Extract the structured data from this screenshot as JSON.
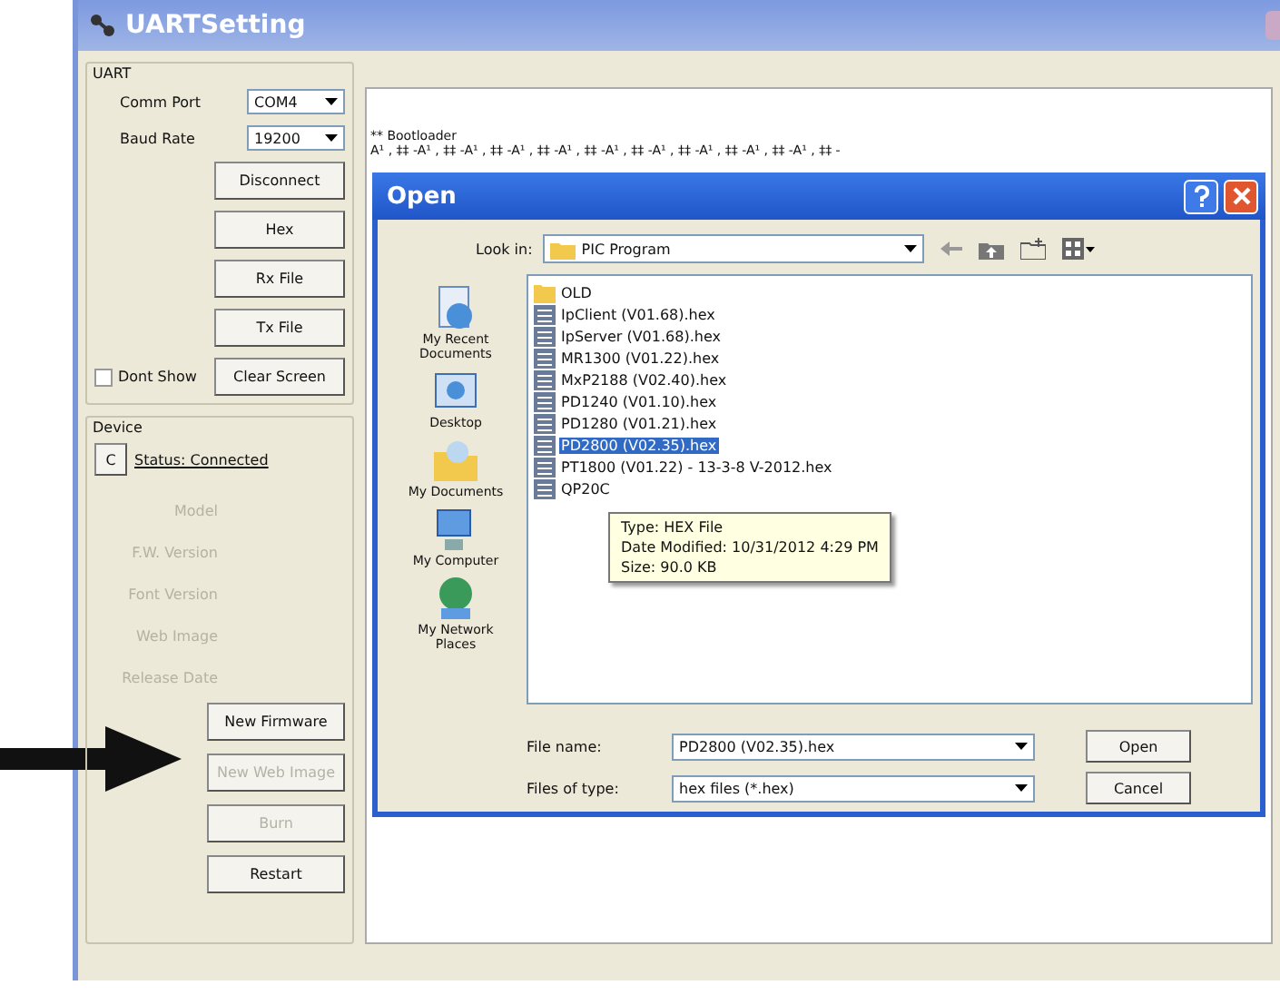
{
  "window": {
    "title": "UARTSetting"
  },
  "uart": {
    "title": "UART",
    "comm_port": {
      "label": "Comm Port",
      "value": "COM4"
    },
    "baud_rate": {
      "label": "Baud Rate",
      "value": "19200"
    },
    "buttons": [
      {
        "label": "Disconnect",
        "disabled": false
      },
      {
        "label": "Hex",
        "disabled": false
      },
      {
        "label": "Rx File",
        "disabled": false
      },
      {
        "label": "Tx File",
        "disabled": false
      }
    ],
    "dont_show": {
      "label": "Dont Show",
      "checked": false
    },
    "clear_button": "Clear Screen"
  },
  "device": {
    "title": "Device",
    "connect_button": "C",
    "status": "Status: Connected",
    "fields": [
      {
        "label": "Model",
        "disabled": true
      },
      {
        "label": "F.W. Version",
        "disabled": true
      },
      {
        "label": "Font Version",
        "disabled": true
      },
      {
        "label": "Web Image",
        "disabled": true
      },
      {
        "label": "Release Date",
        "disabled": true
      }
    ],
    "buttons": [
      {
        "label": "New Firmware",
        "disabled": false
      },
      {
        "label": "New Web Image",
        "disabled": true
      },
      {
        "label": "Burn",
        "disabled": true
      },
      {
        "label": "Restart",
        "disabled": false
      }
    ]
  },
  "console": {
    "lines": [
      "** Bootloader",
      "A¹ , ‡‡ -A¹ , ‡‡ -A¹ , ‡‡ -A¹ , ‡‡ -A¹ , ‡‡ -A¹ , ‡‡ -A¹ , ‡‡ -A¹ , ‡‡ -A¹ , ‡‡ -A¹ , ‡‡ -"
    ]
  },
  "open_dialog": {
    "title": "Open",
    "look_in": {
      "label": "Look in:",
      "value": "PIC Program"
    },
    "places": [
      {
        "label": "My Recent Documents",
        "kind": "recent"
      },
      {
        "label": "Desktop",
        "kind": "desktop"
      },
      {
        "label": "My Documents",
        "kind": "documents"
      },
      {
        "label": "My Computer",
        "kind": "computer"
      },
      {
        "label": "My Network Places",
        "kind": "network"
      }
    ],
    "files": [
      {
        "name": "OLD",
        "kind": "folder",
        "selected": false
      },
      {
        "name": "IpClient (V01.68).hex",
        "kind": "hex",
        "selected": false
      },
      {
        "name": "IpServer (V01.68).hex",
        "kind": "hex",
        "selected": false
      },
      {
        "name": "MR1300 (V01.22).hex",
        "kind": "hex",
        "selected": false
      },
      {
        "name": "MxP2188 (V02.40).hex",
        "kind": "hex",
        "selected": false
      },
      {
        "name": "PD1240 (V01.10).hex",
        "kind": "hex",
        "selected": false
      },
      {
        "name": "PD1280 (V01.21).hex",
        "kind": "hex",
        "selected": false
      },
      {
        "name": "PD2800 (V02.35).hex",
        "kind": "hex",
        "selected": true
      },
      {
        "name": "PT1800 (V01.22) - 13-3-8 V-2012.hex",
        "kind": "hex",
        "selected": false
      },
      {
        "name": "QP20C",
        "kind": "hex",
        "selected": false
      }
    ],
    "tooltip": [
      "Type: HEX File",
      "Date Modified: 10/31/2012 4:29 PM",
      "Size: 90.0 KB"
    ],
    "file_name": {
      "label": "File name:",
      "value": "PD2800 (V02.35).hex"
    },
    "file_type": {
      "label": "Files of type:",
      "value": "hex files (*.hex)"
    },
    "buttons": [
      "Open",
      "Cancel"
    ]
  }
}
